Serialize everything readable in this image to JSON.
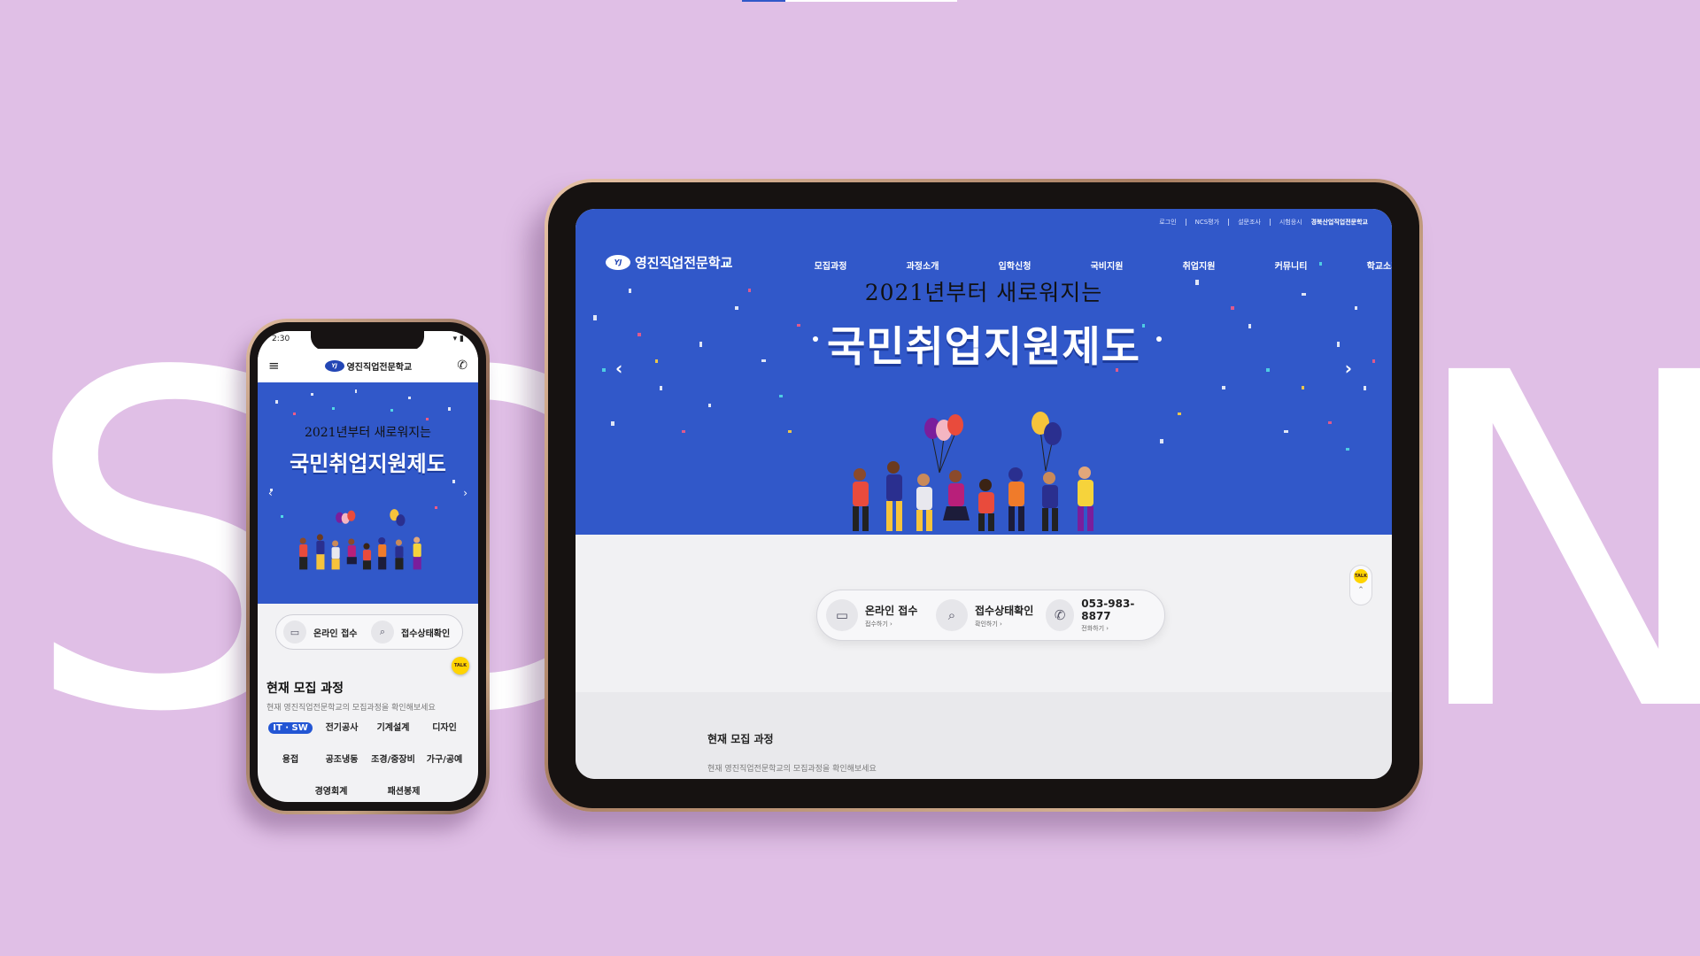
{
  "background": {
    "word_left": "S",
    "word_mid": "C",
    "word_right": "N",
    "color": "#e0bfe6"
  },
  "tablet": {
    "utility_links": [
      "로그인",
      "NCS평가",
      "설문조사",
      "시험응시"
    ],
    "emblem": "경북산업직업전문학교",
    "logo": "영진직업전문학교",
    "nav": [
      "모집과정",
      "과정소개",
      "입학신청",
      "국비지원",
      "취업지원",
      "커뮤니티",
      "학교소개"
    ],
    "hero_subtitle": "2021년부터 새로워지는",
    "hero_title": "국민취업지원제도",
    "quick": [
      {
        "label": "온라인 접수",
        "sub": "접수하기  ›",
        "icon": "monitor-icon"
      },
      {
        "label": "접수상태확인",
        "sub": "확인하기  ›",
        "icon": "search-monitor-icon"
      },
      {
        "label": "053-983-8877",
        "sub": "전화하기  ›",
        "icon": "phone-icon"
      }
    ],
    "section_title": "현재 모집 과정",
    "section_desc": "현재 영진직업전문학교의 모집과정을 확인해보세요",
    "kakao_label": "TALK",
    "hero_color": "#3158c9"
  },
  "phone": {
    "time": "2:30",
    "logo": "영진직업전문학교",
    "hero_subtitle": "2021년부터 새로워지는",
    "hero_title": "국민취업지원제도",
    "quick": [
      {
        "label": "온라인 접수",
        "icon": "monitor-icon"
      },
      {
        "label": "접수상태확인",
        "icon": "search-monitor-icon"
      }
    ],
    "kakao_label": "TALK",
    "section_title": "현재 모집 과정",
    "section_desc": "현재 영진직업전문학교의 모집과정을 확인해보세요",
    "categories_row1": [
      "IT · SW",
      "전기공사",
      "기계설계",
      "디자인"
    ],
    "categories_row2": [
      "용접",
      "공조냉동",
      "조경/중장비",
      "가구/공예"
    ],
    "categories_row3": [
      "경영회계",
      "패션봉제"
    ]
  }
}
